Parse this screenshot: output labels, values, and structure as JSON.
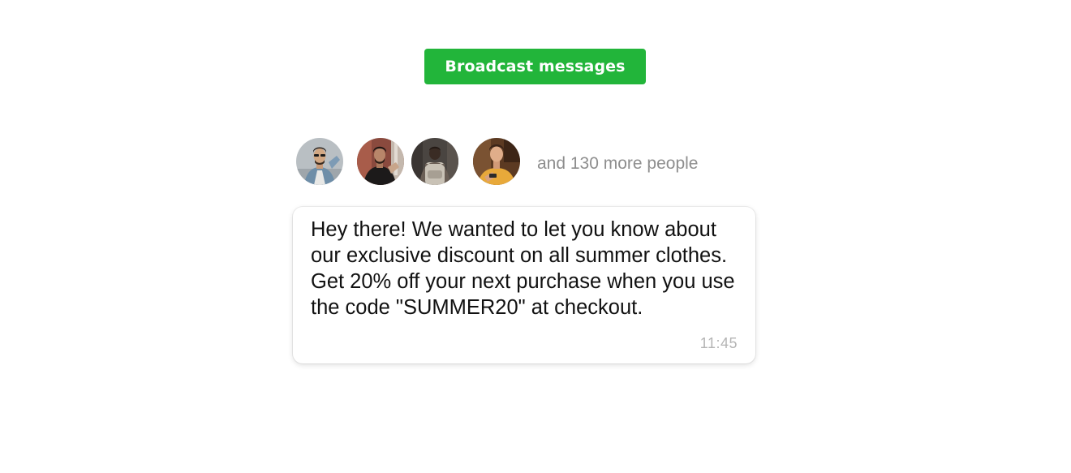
{
  "broadcast_button": {
    "label": "Broadcast messages"
  },
  "recipients": {
    "avatars": [
      {
        "icon": "person-avatar-denim-jacket"
      },
      {
        "icon": "person-avatar-dark-shirt"
      },
      {
        "icon": "person-avatar-backpack"
      },
      {
        "icon": "person-avatar-yellow-shirt"
      }
    ],
    "more_text": "and 130 more people"
  },
  "message": {
    "text": "Hey there! We wanted to let you know about our exclusive discount on all summer clothes. Get 20% off your next purchase when you use the code \"SUMMER20\" at checkout.",
    "time": "11:45"
  },
  "colors": {
    "accent_green": "#22b53a",
    "muted_text": "#8e8e8e",
    "time_text": "#b4b4b4"
  }
}
